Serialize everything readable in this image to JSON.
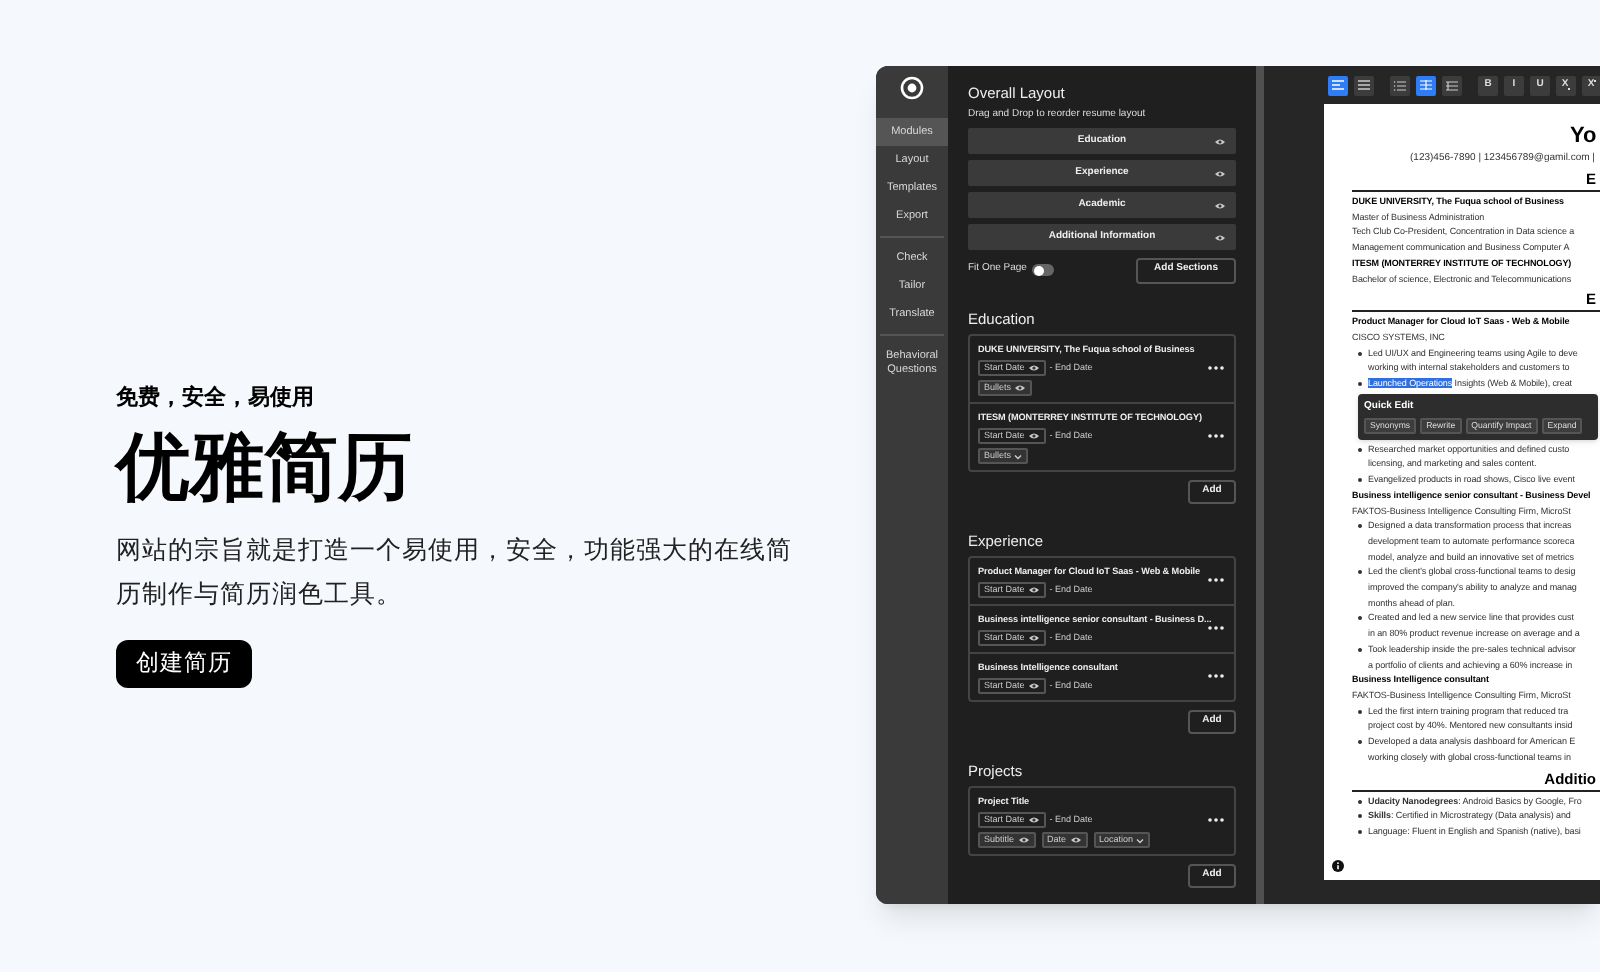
{
  "hero": {
    "tagline": "免费，安全，易使用",
    "title": "优雅简历",
    "description": "网站的宗旨就是打造一个易使用，安全，功能强大的在线简历制作与简历润色工具。",
    "cta": "创建简历"
  },
  "app": {
    "nav_groups": [
      [
        {
          "label": "Modules",
          "selected": true
        },
        {
          "label": "Layout",
          "selected": false
        },
        {
          "label": "Templates",
          "selected": false
        },
        {
          "label": "Export",
          "selected": false
        }
      ],
      [
        {
          "label": "Check",
          "selected": false
        },
        {
          "label": "Tailor",
          "selected": false
        },
        {
          "label": "Translate",
          "selected": false
        }
      ],
      [
        {
          "label": "Behavioral Questions",
          "selected": false
        }
      ]
    ],
    "layout_panel": {
      "title": "Overall Layout",
      "hint": "Drag and Drop to reorder resume layout",
      "sections": [
        "Education",
        "Experience",
        "Academic",
        "Additional Information"
      ],
      "fit_one_page": {
        "label": "Fit One Page",
        "on": false
      },
      "add_sections": "Add Sections"
    },
    "sections": [
      {
        "title": "Education",
        "add": "Add",
        "entries": [
          {
            "title": "DUKE UNIVERSITY, The Fuqua school of Business",
            "start": "Start Date",
            "end": "- End Date",
            "tags": [
              {
                "label": "Bullets",
                "kind": "eye"
              }
            ]
          },
          {
            "title": "ITESM (MONTERREY INSTITUTE OF TECHNOLOGY)",
            "start": "Start Date",
            "end": "- End Date",
            "tags": [
              {
                "label": "Bullets",
                "kind": "chevron"
              }
            ]
          }
        ]
      },
      {
        "title": "Experience",
        "add": "Add",
        "entries": [
          {
            "title": "Product Manager for Cloud IoT Saas - Web & Mobile",
            "start": "Start Date",
            "end": "- End Date"
          },
          {
            "title": "Business intelligence senior consultant - Business D...",
            "start": "Start Date",
            "end": "- End Date"
          },
          {
            "title": "Business Intelligence consultant",
            "start": "Start Date",
            "end": "- End Date"
          }
        ]
      },
      {
        "title": "Projects",
        "add": "Add",
        "entries": [
          {
            "title": "Project Title",
            "start": "Start Date",
            "end": "- End Date",
            "tags": [
              {
                "label": "Subtitle",
                "kind": "eye"
              },
              {
                "label": "Date",
                "kind": "eye"
              },
              {
                "label": "Location",
                "kind": "chevron"
              }
            ]
          }
        ]
      }
    ],
    "toolbar": [
      {
        "kind": "align-left",
        "selected": true
      },
      {
        "kind": "align-justify",
        "selected": false
      },
      {
        "kind": "list",
        "selected": false
      },
      {
        "kind": "columns",
        "selected": true
      },
      {
        "kind": "rows",
        "selected": false
      },
      {
        "kind": "text",
        "label": "B",
        "selected": false
      },
      {
        "kind": "text",
        "label": "I",
        "selected": false
      },
      {
        "kind": "text",
        "label": "U",
        "selected": false
      },
      {
        "kind": "sub",
        "label": "X",
        "selected": false
      },
      {
        "kind": "sup",
        "label": "X",
        "selected": false
      }
    ],
    "resume": [
      {
        "kind": "name",
        "text": "Yo"
      },
      {
        "kind": "contact",
        "text": "(123)456-7890 | 123456789@gamil.com |"
      },
      {
        "kind": "heading",
        "text": "E"
      },
      {
        "kind": "title",
        "text": "DUKE UNIVERSITY, The Fuqua school of Business"
      },
      {
        "kind": "line",
        "text": "Master of Business Administration"
      },
      {
        "kind": "line",
        "text": "Tech Club Co-President, Concentration in Data science a"
      },
      {
        "kind": "line",
        "text": "Management communication and Business Computer A"
      },
      {
        "kind": "title",
        "text": "ITESM (MONTERREY INSTITUTE OF TECHNOLOGY)"
      },
      {
        "kind": "line",
        "text": "Bachelor of science, Electronic and Telecommunications"
      },
      {
        "kind": "heading",
        "text": "E"
      },
      {
        "kind": "title",
        "text": "Product Manager for Cloud IoT Saas - Web & Mobile"
      },
      {
        "kind": "line",
        "text": "CISCO SYSTEMS, INC"
      },
      {
        "kind": "bullet",
        "lines": [
          "Led UI/UX and Engineering teams using Agile to deve",
          "working with internal stakeholders and customers to"
        ]
      },
      {
        "kind": "bullet",
        "highlight": "Launched Operations",
        "lines": [
          "Insights (Web & Mobile), creat"
        ]
      },
      {
        "kind": "quick_edit",
        "title": "Quick Edit",
        "actions": [
          "Synonyms",
          "Rewrite",
          "Quantify Impact",
          "Expand"
        ]
      },
      {
        "kind": "bullet",
        "lines": [
          "Researched market opportunities and defined custo",
          "licensing, and marketing and sales content."
        ]
      },
      {
        "kind": "bullet",
        "lines": [
          "Evangelized products in road shows, Cisco live event"
        ]
      },
      {
        "kind": "title",
        "text": "Business intelligence senior consultant - Business Devel"
      },
      {
        "kind": "line",
        "text": "FAKTOS-Business Intelligence Consulting Firm, MicroSt"
      },
      {
        "kind": "bullet",
        "lines": [
          "Designed a data transformation process that increas",
          "development team to automate performance scoreca",
          "model, analyze and build an innovative set of metrics"
        ]
      },
      {
        "kind": "bullet",
        "lines": [
          "Led the client's global cross-functional teams to desig",
          "improved the company's ability to analyze and manag",
          "months ahead of plan."
        ]
      },
      {
        "kind": "bullet",
        "lines": [
          "Created and led a new service line that provides cust",
          "in an 80% product revenue increase on average and a"
        ]
      },
      {
        "kind": "bullet",
        "lines": [
          "Took leadership inside the pre-sales technical advisor",
          "a portfolio of clients and achieving a 60% increase in"
        ]
      },
      {
        "kind": "title",
        "text": "Business Intelligence consultant"
      },
      {
        "kind": "line",
        "text": "FAKTOS-Business Intelligence Consulting Firm, MicroSt"
      },
      {
        "kind": "bullet",
        "lines": [
          "Led the first intern training program that reduced tra",
          "project cost by 40%. Mentored new consultants insid"
        ]
      },
      {
        "kind": "bullet",
        "lines": [
          "Developed a data analysis dashboard for American E",
          "working closely with global cross-functional teams in"
        ]
      },
      {
        "kind": "heading",
        "text": "Additio"
      },
      {
        "kind": "bullet",
        "lines": [
          "**Udacity Nanodegrees**: Android Basics by Google, Fro"
        ]
      },
      {
        "kind": "bullet",
        "lines": [
          "**Skills**: Certified in Microstrategy (Data analysis) and"
        ]
      },
      {
        "kind": "bullet",
        "lines": [
          "Language: Fluent in English and Spanish (native), basi"
        ]
      }
    ]
  }
}
